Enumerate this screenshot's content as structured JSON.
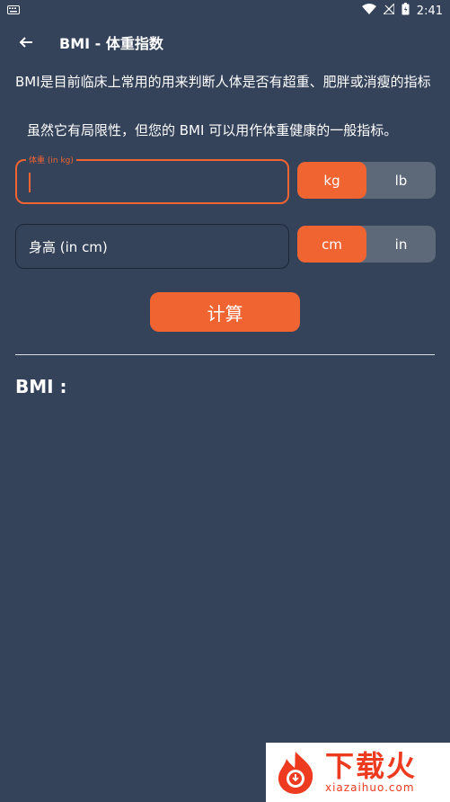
{
  "status_bar": {
    "time": "2:41"
  },
  "app_bar": {
    "title": "BMI - 体重指数"
  },
  "description": {
    "line1": "BMI是目前临床上常用的用来判断人体是否有超重、肥胖或消瘦的指标",
    "line2": "虽然它有局限性，但您的 BMI 可以用作体重健康的一般指标。"
  },
  "weight": {
    "label": "体重 (in kg)",
    "value": "",
    "units": [
      "kg",
      "lb"
    ],
    "selected_unit": "kg"
  },
  "height": {
    "placeholder": "身高 (in cm)",
    "units": [
      "cm",
      "in"
    ],
    "selected_unit": "cm"
  },
  "calculate_label": "计算",
  "result": {
    "label": "BMI :"
  },
  "watermark": {
    "text": "下载火",
    "site": "xiazaihuo.com"
  },
  "colors": {
    "accent": "#ef6431",
    "background": "#34425a",
    "toggle_off": "#5d6878"
  }
}
